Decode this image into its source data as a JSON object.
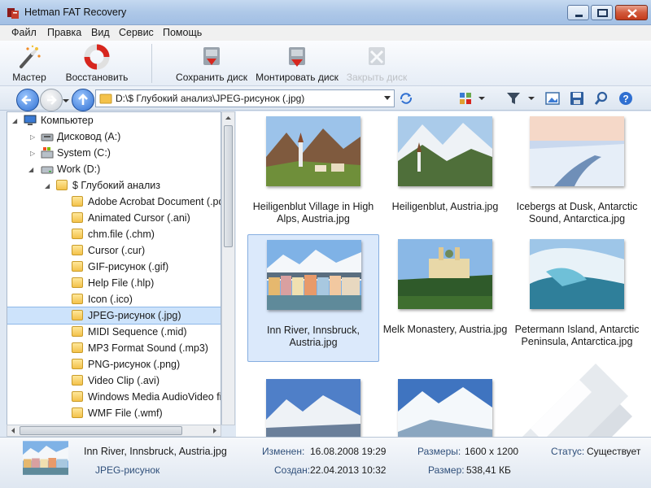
{
  "window": {
    "title": "Hetman FAT Recovery"
  },
  "menu": [
    "Файл",
    "Правка",
    "Вид",
    "Сервис",
    "Помощь"
  ],
  "toolbar": {
    "wizard": "Мастер",
    "restore": "Восстановить",
    "save_disk": "Сохранить диск",
    "mount_disk": "Монтировать диск",
    "close_disk": "Закрыть диск"
  },
  "address": {
    "path": "D:\\$ Глубокий анализ\\JPEG-рисунок (.jpg)"
  },
  "tree": {
    "computer": "Компьютер",
    "drive_a": "Дисковод (A:)",
    "drive_c": "System (C:)",
    "drive_d": "Work (D:)",
    "deep": "$ Глубокий анализ",
    "folders": [
      "Adobe Acrobat Document (.pdf",
      "Animated Cursor (.ani)",
      "chm.file (.chm)",
      "Cursor (.cur)",
      "GIF-рисунок (.gif)",
      "Help File (.hlp)",
      "Icon (.ico)",
      "JPEG-рисунок (.jpg)",
      "MIDI Sequence (.mid)",
      "MP3 Format Sound (.mp3)",
      "PNG-рисунок (.png)",
      "Video Clip (.avi)",
      "Windows Media AudioVideo fil",
      "WMF File (.wmf)"
    ]
  },
  "files": [
    {
      "name": "Heiligenblut Village in High Alps, Austria.jpg"
    },
    {
      "name": "Heiligenblut, Austria.jpg"
    },
    {
      "name": "Icebergs at Dusk, Antarctic Sound, Antarctica.jpg"
    },
    {
      "name": "Inn River, Innsbruck, Austria.jpg"
    },
    {
      "name": "Melk Monastery, Austria.jpg"
    },
    {
      "name": "Petermann Island, Antarctic Peninsula, Antarctica.jpg"
    },
    {
      "name": ""
    },
    {
      "name": ""
    }
  ],
  "status": {
    "name": "Inn River, Innsbruck, Austria.jpg",
    "type": "JPEG-рисунок",
    "modified_label": "Изменен:",
    "modified": "16.08.2008 19:29",
    "created_label": "Создан:",
    "created": "22.04.2013 10:32",
    "dims_label": "Размеры:",
    "dims": "1600 x 1200",
    "size_label": "Размер:",
    "size": "538,41 КБ",
    "state_label": "Статус:",
    "state": "Существует"
  },
  "colors": {
    "accent": "#3b7bd4",
    "selection": "#cde3fb"
  }
}
